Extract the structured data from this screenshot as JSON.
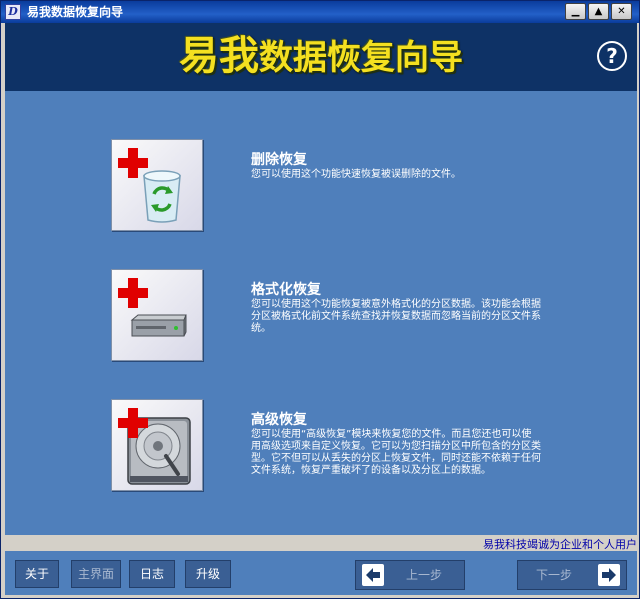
{
  "window": {
    "app_icon": "D",
    "title": "易我数据恢复向导",
    "buttons": [
      "minimize",
      "restore",
      "close"
    ]
  },
  "banner": {
    "title_part1": "易我",
    "title_part2": "数据恢复向导",
    "help_icon_label": "?"
  },
  "options": [
    {
      "title": "删除恢复",
      "description": "您可以使用这个功能快速恢复被误删除的文件。",
      "icon": "recycle-bin-icon"
    },
    {
      "title": "格式化恢复",
      "description": "您可以使用这个功能恢复被意外格式化的分区数据。该功能会根据分区被格式化前文件系统查找并恢复数据而忽略当前的分区文件系统。",
      "icon": "drive-icon"
    },
    {
      "title": "高级恢复",
      "description": "您可以使用“高级恢复”模块来恢复您的文件。而且您还也可以使用高级选项来自定义恢复。它可以为您扫描分区中所包含的分区类型。它不但可以从丢失的分区上恢复文件，同时还能不依赖于任何文件系统，恢复严重破坏了的设备以及分区上的数据。",
      "icon": "hard-disk-icon"
    }
  ],
  "status": {
    "text": "易我科技竭诚为企业和个人用户"
  },
  "toolbar": {
    "about": "关于",
    "main": "主界面",
    "log": "日志",
    "upgrade": "升级",
    "prev": "上一步",
    "next": "下一步"
  }
}
